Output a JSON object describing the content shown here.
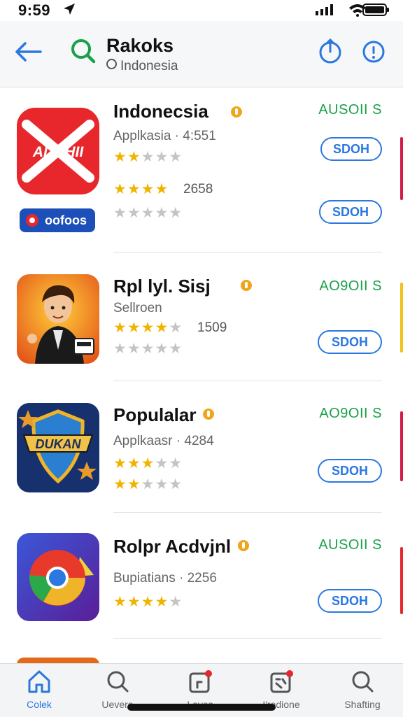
{
  "status_bar": {
    "time": "9:59"
  },
  "header": {
    "title": "Rakoks",
    "subtitle": "Indonesia",
    "icons": [
      "back-arrow-icon",
      "search-icon",
      "refresh-icon",
      "info-icon"
    ]
  },
  "apps": [
    {
      "name": "Indonecsia",
      "meta": "Applkasia · 4:551",
      "rating_count": "2658",
      "price": "AUSOII S",
      "button_1": "SDOH",
      "button_2": "SDOH",
      "icon_text": "ADKHII",
      "icon_sub_text": "oofoos",
      "stars_1": 2,
      "stars_2": 4,
      "stars_3": 0,
      "accent": "#e8272d"
    },
    {
      "name": "Rpl lyl. Sisj",
      "meta": "Sellroen",
      "rating_count": "1509",
      "price": "AO9OII S",
      "button_1": "SDOH",
      "stars_1": 4,
      "stars_2": 0,
      "accent": "#f0a020"
    },
    {
      "name": "Populalar",
      "meta": "Applkaasr · 4284",
      "price": "AO9OII S",
      "button_1": "SDOH",
      "icon_text": "DUKAN",
      "stars_1": 3,
      "stars_2": 2,
      "accent": "#1d3d8a"
    },
    {
      "name": "Rolpr Acdvjnl",
      "meta": "Bupiatians · 2256",
      "price": "AUSOII S",
      "button_1": "SDOH",
      "stars_1": 4,
      "accent": "#4a2fb8"
    }
  ],
  "tabs": [
    {
      "label": "Colek",
      "icon": "home-icon",
      "active": true
    },
    {
      "label": "Uevero",
      "icon": "search-icon",
      "active": false
    },
    {
      "label": "Layes",
      "icon": "layers-icon",
      "active": false
    },
    {
      "label": "I'redione",
      "icon": "updates-icon",
      "active": false
    },
    {
      "label": "Shafting",
      "icon": "search-icon",
      "active": false
    }
  ],
  "colors": {
    "accent_blue": "#2a78e0",
    "price_green": "#1aa04a",
    "star_gold": "#f0b400",
    "search_green": "#1aa04a"
  }
}
